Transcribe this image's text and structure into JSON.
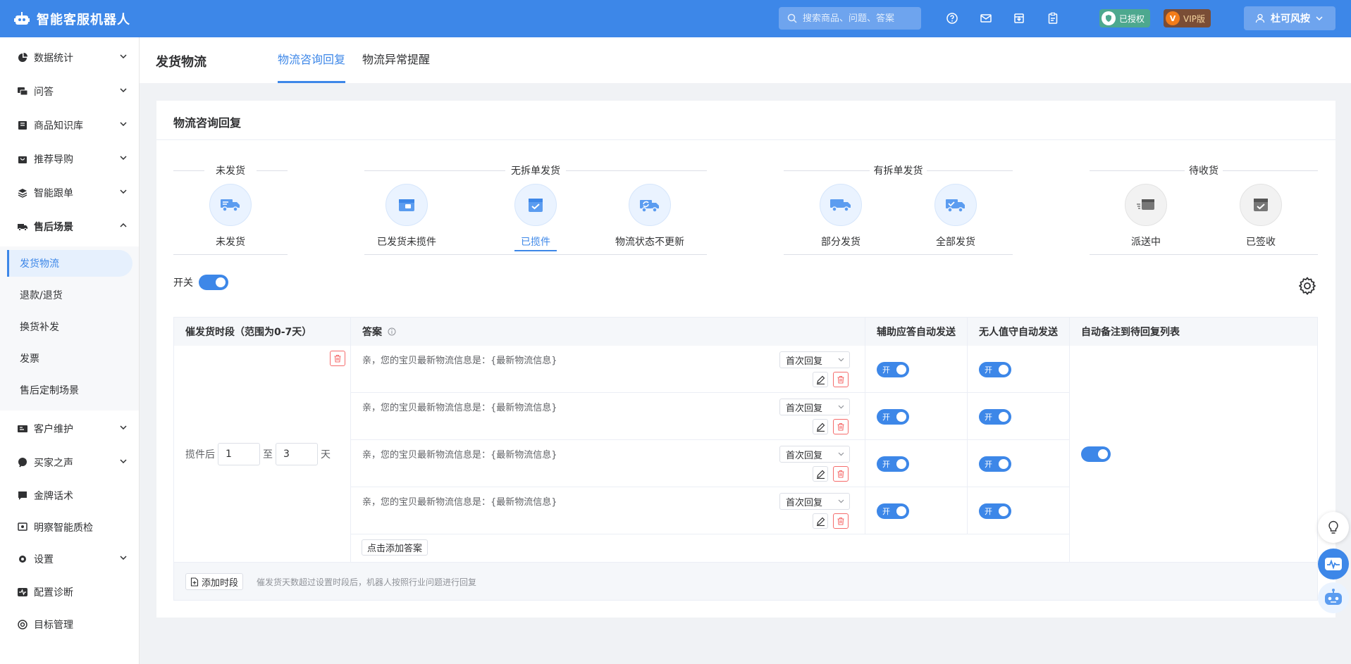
{
  "app": {
    "title": "智能客服机器人"
  },
  "header": {
    "search_placeholder": "搜索商品、问题、答案",
    "auth_badge": "已授权",
    "vip_badge": "VIP版",
    "vip_mark": "V",
    "user_name": "杜可风按"
  },
  "sidebar": {
    "items": [
      {
        "label": "数据统计"
      },
      {
        "label": "问答"
      },
      {
        "label": "商品知识库"
      },
      {
        "label": "推荐导购"
      },
      {
        "label": "智能跟单"
      },
      {
        "label": "售后场景"
      },
      {
        "label": "客户维护"
      },
      {
        "label": "买家之声"
      },
      {
        "label": "金牌话术"
      },
      {
        "label": "明察智能质检"
      },
      {
        "label": "设置"
      },
      {
        "label": "配置诊断"
      },
      {
        "label": "目标管理"
      }
    ],
    "sub_items": [
      {
        "label": "发货物流"
      },
      {
        "label": "退款/退货"
      },
      {
        "label": "换货补发"
      },
      {
        "label": "发票"
      },
      {
        "label": "售后定制场景"
      }
    ]
  },
  "topbar": {
    "page_title": "发货物流",
    "tabs": [
      {
        "label": "物流咨询回复"
      },
      {
        "label": "物流异常提醒"
      }
    ]
  },
  "card": {
    "title": "物流咨询回复"
  },
  "groups": [
    {
      "title": "未发货",
      "steps": [
        {
          "label": "未发货",
          "icon": "truck-icon"
        }
      ]
    },
    {
      "title": "无拆单发货",
      "steps": [
        {
          "label": "已发货未揽件",
          "icon": "package-icon"
        },
        {
          "label": "已揽件",
          "icon": "box-check-icon"
        },
        {
          "label": "物流状态不更新",
          "icon": "truck-refresh-icon"
        }
      ]
    },
    {
      "title": "有拆单发货",
      "steps": [
        {
          "label": "部分发货",
          "icon": "truck-icon"
        },
        {
          "label": "全部发货",
          "icon": "truck-check-icon"
        }
      ]
    },
    {
      "title": "待收货",
      "steps": [
        {
          "label": "派送中",
          "icon": "delivery-icon"
        },
        {
          "label": "已签收",
          "icon": "signed-box-icon"
        }
      ]
    }
  ],
  "switch_label": "开关",
  "table": {
    "headers": [
      "催发货时段（范围为0-7天）",
      "答案",
      "辅助应答自动发送",
      "无人值守自动发送",
      "自动备注到待回复列表"
    ],
    "period": {
      "prefix": "揽件后",
      "from": "1",
      "sep": "至",
      "to": "3",
      "unit": "天"
    },
    "toggle_text": "开",
    "answers": [
      {
        "text": "亲，您的宝贝最新物流信息是：{最新物流信息}",
        "mode": "首次回复"
      },
      {
        "text": "亲，您的宝贝最新物流信息是：{最新物流信息}",
        "mode": "首次回复"
      },
      {
        "text": "亲，您的宝贝最新物流信息是：{最新物流信息}",
        "mode": "首次回复"
      },
      {
        "text": "亲，您的宝贝最新物流信息是：{最新物流信息}",
        "mode": "首次回复"
      }
    ],
    "add_answer": "点击添加答案",
    "add_period": "添加时段",
    "footer_note": "催发货天数超过设置时段后，机器人按照行业问题进行回复"
  },
  "colors": {
    "primary": "#3d87e8",
    "danger": "#f56c6c"
  }
}
